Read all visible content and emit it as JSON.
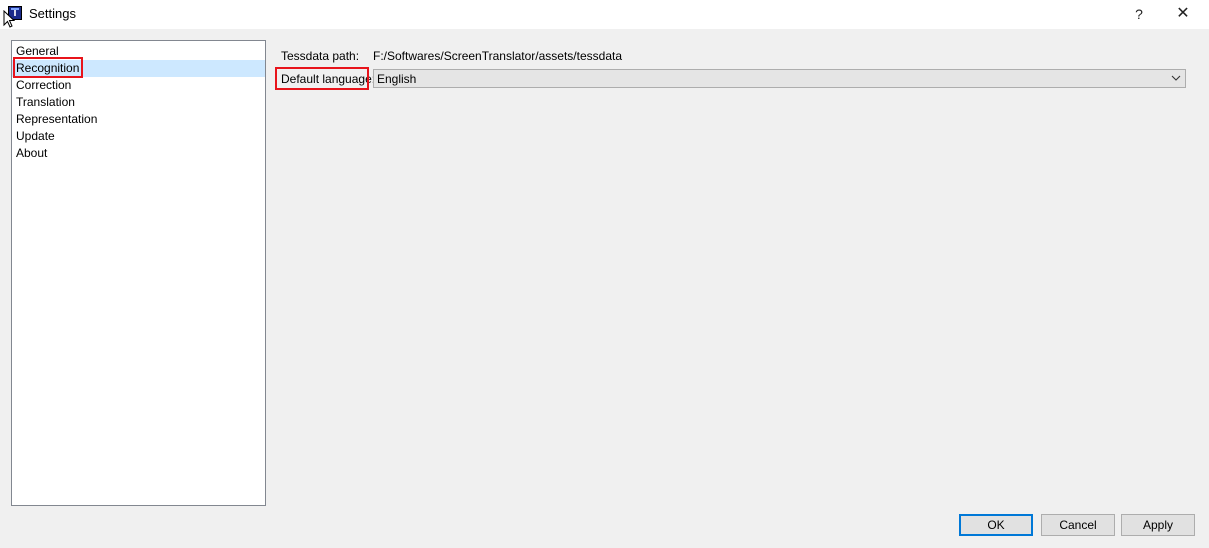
{
  "window": {
    "title": "Settings",
    "app_icon_letter": "T",
    "help_glyph": "?",
    "close_glyph": "✕"
  },
  "sidebar": {
    "items": [
      {
        "label": "General"
      },
      {
        "label": "Recognition",
        "selected": true
      },
      {
        "label": "Correction"
      },
      {
        "label": "Translation"
      },
      {
        "label": "Representation"
      },
      {
        "label": "Update"
      },
      {
        "label": "About"
      }
    ]
  },
  "recognition": {
    "tessdata_label": "Tessdata path:",
    "tessdata_value": "F:/Softwares/ScreenTranslator/assets/tessdata",
    "language_label": "Default language:",
    "language_value": "English"
  },
  "buttons": {
    "ok": "OK",
    "cancel": "Cancel",
    "apply": "Apply"
  },
  "colors": {
    "highlight_border": "#e8141b",
    "selection_bg": "#cde8ff",
    "default_button_border": "#0078d7"
  }
}
